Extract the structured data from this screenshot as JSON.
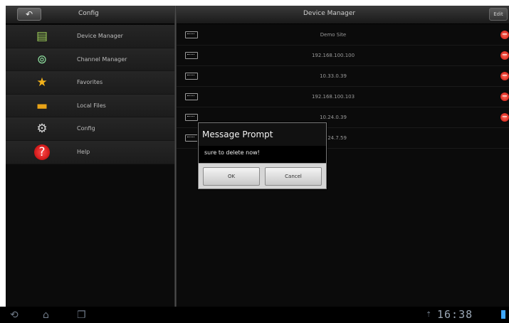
{
  "topbar": {
    "back_glyph": "↶",
    "left_title": "Config",
    "right_title": "Device Manager",
    "edit_label": "Edit"
  },
  "menu": [
    {
      "label": "Device Manager",
      "icon": "device-manager-icon"
    },
    {
      "label": "Channel Manager",
      "icon": "channel-manager-icon"
    },
    {
      "label": "Favorites",
      "icon": "star-icon"
    },
    {
      "label": "Local Files",
      "icon": "folder-icon"
    },
    {
      "label": "Config",
      "icon": "gear-icon"
    },
    {
      "label": "Help",
      "icon": "help-icon"
    }
  ],
  "devices": [
    {
      "label": "Demo Site"
    },
    {
      "label": "192.168.100.100"
    },
    {
      "label": "10.33.0.39"
    },
    {
      "label": "192.168.100.103"
    },
    {
      "label": "10.24.0.39"
    },
    {
      "label": "10.24.7.59"
    }
  ],
  "dialog": {
    "title": "Message Prompt",
    "message": "sure to delete now!",
    "ok_label": "OK",
    "cancel_label": "Cancel"
  },
  "statusbar": {
    "clock": "16:38"
  },
  "colors": {
    "delete_red": "#d0140b",
    "clock_blue": "#9aa6b4"
  }
}
